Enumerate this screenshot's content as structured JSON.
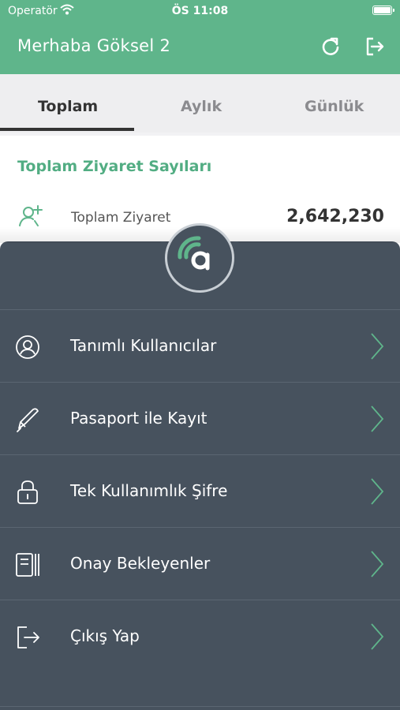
{
  "status_bar": {
    "carrier": "Operatör",
    "time": "ÖS 11:08"
  },
  "header": {
    "title": "Merhaba Göksel 2",
    "background_color": "#5fb58b",
    "refresh_icon": "refresh-icon",
    "logout_icon": "logout-icon"
  },
  "tabs": [
    {
      "label": "Toplam",
      "active": true
    },
    {
      "label": "Aylık",
      "active": false
    },
    {
      "label": "Günlük",
      "active": false
    }
  ],
  "content": {
    "section_title": "Toplam Ziyaret Sayıları",
    "stat_icon": "add-user-icon",
    "stat_label": "Toplam Ziyaret",
    "stat_value": "2,642,230"
  },
  "drawer": {
    "background_color": "#47525e",
    "accent_color": "#5fb58b",
    "logo": "app-logo",
    "items": [
      {
        "label": "Tanımlı Kullanıcılar",
        "icon": "user-circle-icon"
      },
      {
        "label": "Pasaport ile Kayıt",
        "icon": "pen-icon"
      },
      {
        "label": "Tek Kullanımlık Şifre",
        "icon": "lock-icon"
      },
      {
        "label": "Onay Bekleyenler",
        "icon": "pending-list-icon"
      },
      {
        "label": "Çıkış Yap",
        "icon": "exit-icon"
      }
    ]
  }
}
